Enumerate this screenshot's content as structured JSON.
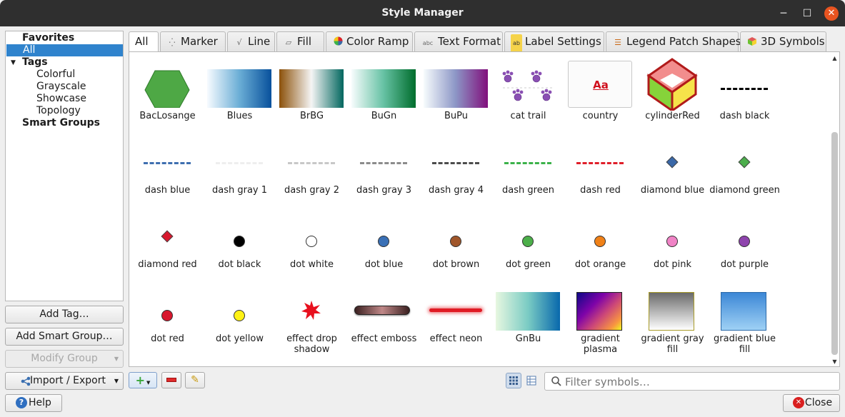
{
  "window": {
    "title": "Style Manager"
  },
  "window_controls": {
    "minimize": "─",
    "maximize": "☐",
    "close": "✕"
  },
  "tree": {
    "items": [
      {
        "label": "Favorites",
        "bold": true
      },
      {
        "label": "All",
        "selected": true
      },
      {
        "label": "Tags",
        "bold": true,
        "expanded": true
      },
      {
        "label": "Colorful"
      },
      {
        "label": "Grayscale"
      },
      {
        "label": "Showcase"
      },
      {
        "label": "Topology"
      },
      {
        "label": "Smart Groups",
        "bold": true
      }
    ]
  },
  "left_buttons": {
    "add_tag": "Add Tag…",
    "add_smart_group": "Add Smart Group…",
    "modify_group": "Modify Group",
    "import_export": "Import / Export",
    "help": "Help"
  },
  "tabs": [
    {
      "label": "All",
      "icon": ""
    },
    {
      "label": "Marker",
      "icon": "marker-icon"
    },
    {
      "label": "Line",
      "icon": "line-icon"
    },
    {
      "label": "Fill",
      "icon": "fill-icon"
    },
    {
      "label": "Color Ramp",
      "icon": "color-ramp-icon"
    },
    {
      "label": "Text Format",
      "icon": "text-format-icon"
    },
    {
      "label": "Label Settings",
      "icon": "label-settings-icon"
    },
    {
      "label": "Legend Patch Shapes",
      "icon": "legend-patch-icon"
    },
    {
      "label": "3D Symbols",
      "icon": "3d-symbols-icon"
    }
  ],
  "tab_icon_glyphs": {
    "marker": "⁛",
    "line": "√",
    "fill": "▱",
    "text_format": "abc",
    "label_settings": "abc",
    "legend": "☰",
    "label_settings_short": "ab"
  },
  "symbols": [
    {
      "name": "BacLosange",
      "kind": "hexagon",
      "color": "#4ea845"
    },
    {
      "name": "Blues",
      "kind": "ramp",
      "colors": [
        "#f7fbff",
        "#6baed6",
        "#08519c"
      ]
    },
    {
      "name": "BrBG",
      "kind": "ramp",
      "colors": [
        "#8c510a",
        "#f5f5f5",
        "#01665e"
      ]
    },
    {
      "name": "BuGn",
      "kind": "ramp",
      "colors": [
        "#f7fcfd",
        "#66c2a4",
        "#006d2c"
      ]
    },
    {
      "name": "BuPu",
      "kind": "ramp",
      "colors": [
        "#f7fcfd",
        "#8c96c6",
        "#810f7c"
      ]
    },
    {
      "name": "cat trail",
      "kind": "paws",
      "color": "#8a4fb3"
    },
    {
      "name": "country",
      "kind": "text",
      "text": "Aa",
      "color": "#d0101e",
      "selected": true
    },
    {
      "name": "cylinderRed",
      "kind": "cube"
    },
    {
      "name": "dash  black",
      "kind": "dash",
      "color": "#000000"
    },
    {
      "name": "dash blue",
      "kind": "dash",
      "color": "#3f6fb0"
    },
    {
      "name": "dash gray 1",
      "kind": "dash",
      "color": "#eeeeee"
    },
    {
      "name": "dash gray 2",
      "kind": "dash",
      "color": "#c8c8c8"
    },
    {
      "name": "dash gray 3",
      "kind": "dash",
      "color": "#8c8c8c"
    },
    {
      "name": "dash gray 4",
      "kind": "dash",
      "color": "#4c4c4c"
    },
    {
      "name": "dash green",
      "kind": "dash",
      "color": "#3cb24a"
    },
    {
      "name": "dash red",
      "kind": "dash",
      "color": "#e0202a"
    },
    {
      "name": "diamond blue",
      "kind": "diamond",
      "color": "#3a68a8"
    },
    {
      "name": "diamond green",
      "kind": "diamond",
      "color": "#4cae4c"
    },
    {
      "name": "diamond red",
      "kind": "diamond",
      "color": "#d8172d"
    },
    {
      "name": "dot  black",
      "kind": "dot",
      "color": "#000000"
    },
    {
      "name": "dot  white",
      "kind": "dot",
      "color": "#ffffff"
    },
    {
      "name": "dot blue",
      "kind": "dot",
      "color": "#3a70b6"
    },
    {
      "name": "dot brown",
      "kind": "dot",
      "color": "#a0562a"
    },
    {
      "name": "dot green",
      "kind": "dot",
      "color": "#4caf4a"
    },
    {
      "name": "dot orange",
      "kind": "dot",
      "color": "#f08118"
    },
    {
      "name": "dot pink",
      "kind": "dot",
      "color": "#f083c6"
    },
    {
      "name": "dot purple",
      "kind": "dot",
      "color": "#8e44ad"
    },
    {
      "name": "dot red",
      "kind": "dot",
      "color": "#d8172d"
    },
    {
      "name": "dot yellow",
      "kind": "dot",
      "color": "#fff215"
    },
    {
      "name": "effect drop shadow",
      "kind": "star",
      "color": "#e8101e"
    },
    {
      "name": "effect emboss",
      "kind": "emboss"
    },
    {
      "name": "effect neon",
      "kind": "neon",
      "color": "#e01b24"
    },
    {
      "name": "GnBu",
      "kind": "ramp",
      "colors": [
        "#e7f7e0",
        "#7bccc4",
        "#0868ac"
      ]
    },
    {
      "name": "gradient plasma",
      "kind": "plasma"
    },
    {
      "name": "gradient  gray fill",
      "kind": "grayfill"
    },
    {
      "name": "gradient blue fill",
      "kind": "bluefill"
    }
  ],
  "footer": {
    "search_placeholder": "Filter symbols…",
    "close": "Close",
    "add_symbol": "+",
    "remove_symbol": "−",
    "edit_symbol": "✎"
  }
}
